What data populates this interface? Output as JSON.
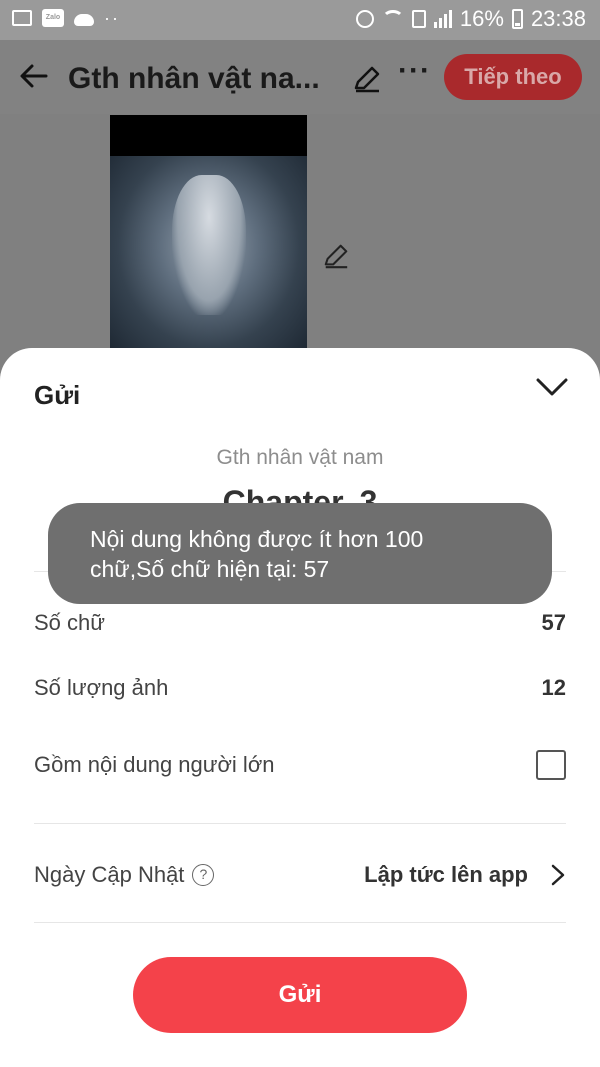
{
  "status_bar": {
    "battery_percent": "16%",
    "time": "23:38",
    "left_icons": [
      "gallery-icon",
      "zalo-icon",
      "cloud-icon",
      "more-dots-icon"
    ],
    "right_icons": [
      "alarm-icon",
      "wifi-icon",
      "sim-icon",
      "signal-icon",
      "battery-icon"
    ]
  },
  "header": {
    "title": "Gth nhân vật na...",
    "next_button": "Tiếp theo",
    "more": "···"
  },
  "sheet": {
    "title": "Gửi",
    "story_name": "Gth nhân vật nam",
    "chapter": "Chapter. 3",
    "word_count_label": "Số chữ",
    "word_count_value": "57",
    "image_count_label": "Số lượng ảnh",
    "image_count_value": "12",
    "adult_content_label": "Gồm nội dung người lớn",
    "adult_content_checked": false,
    "update_date_label": "Ngày Cập Nhật",
    "update_date_value": "Lập tức lên app",
    "submit_button": "Gửi"
  },
  "toast": {
    "line1": "Nội dung không được ít hơn 100",
    "line2": "chữ,Số chữ hiện tại: 57"
  },
  "colors": {
    "primary_red": "#f4424a",
    "dimmed_red": "#a9292c",
    "overlay_gray": "#808080",
    "toast_gray": "#6f6f6f"
  }
}
